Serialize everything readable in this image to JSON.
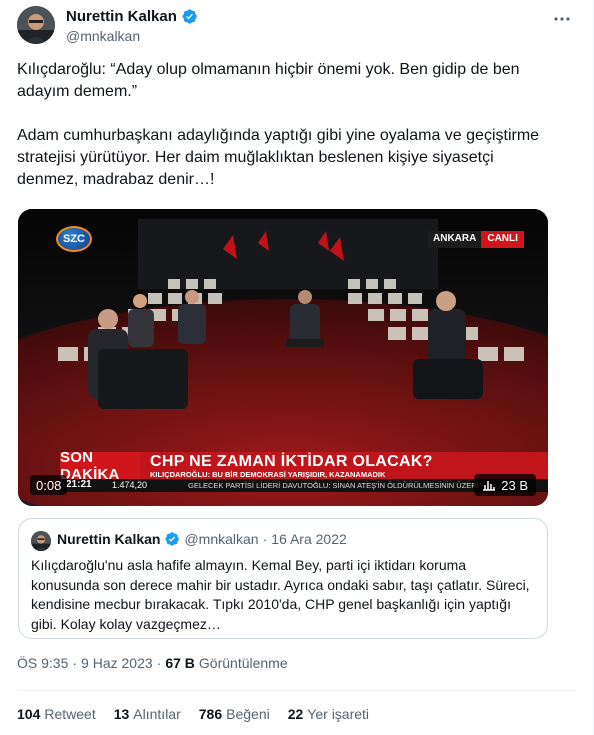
{
  "author": {
    "name": "Nurettin Kalkan",
    "handle": "@mnkalkan",
    "verified_color": "#1d9bf0"
  },
  "tweet": {
    "text": "Kılıçdaroğlu: “Aday olup olmamanın hiçbir önemi yok. Ben gidip de ben\nadayım demem.”\n\nAdam cumhurbaşkanı adaylığında yaptığı gibi yine oyalama ve geçiştirme\nstratejisi yürütüyor. Her daim muğlaklıktan beslenen kişiye siyasetçi\ndenmez, madrabaz denir…!"
  },
  "video": {
    "channel_logo": "SZC",
    "live_location": "ANKARA",
    "live_label": "CANLI",
    "breaking_label": "SON DAKİKA",
    "headline": "CHP NE ZAMAN İKTİDAR OLACAK?",
    "subheadline": "KILIÇDAROĞLU: BU BİR DEMOKRASİ YARIŞIDIR, KAZANAMADIK",
    "clock": "21:21",
    "market": "1.474,20",
    "news_line": "GELECEK PARTİSİ LİDERİ DAVUTOĞLU: SİNAN ATEŞ'İN ÖLDÜRÜLMESİNİN ÜZERİ",
    "elapsed": "0:08",
    "views": "23 B",
    "accent_red": "#d0161a"
  },
  "quote": {
    "name": "Nurettin Kalkan",
    "handle": "@mnkalkan",
    "dot": "·",
    "date": "16 Ara 2022",
    "text": "Kılıçdaroğlu'nu asla hafife almayın. Kemal Bey, parti içi iktidarı koruma konusunda son derece mahir bir ustadır. Ayrıca ondaki sabır, taşı çatlatır. Süreci, kendisine mecbur bırakacak. Tıpkı 2010'da, CHP genel başkanlığı için yaptığı gibi. Kolay kolay vazgeçmez…"
  },
  "meta": {
    "time": "ÖS 9:35",
    "dot1": "·",
    "date": "9 Haz 2023",
    "dot2": "·",
    "views_count": "67 B",
    "views_label": "Görüntülenme"
  },
  "stats": {
    "retweets": "104",
    "retweets_label": "Retweet",
    "quotes": "13",
    "quotes_label": "Alıntılar",
    "likes": "786",
    "likes_label": "Beğeni",
    "bookmarks": "22",
    "bookmarks_label": "Yer işareti"
  },
  "icons": {
    "verified": "verified-badge-icon",
    "more": "more-horizontal-icon",
    "views": "views-chart-icon"
  }
}
